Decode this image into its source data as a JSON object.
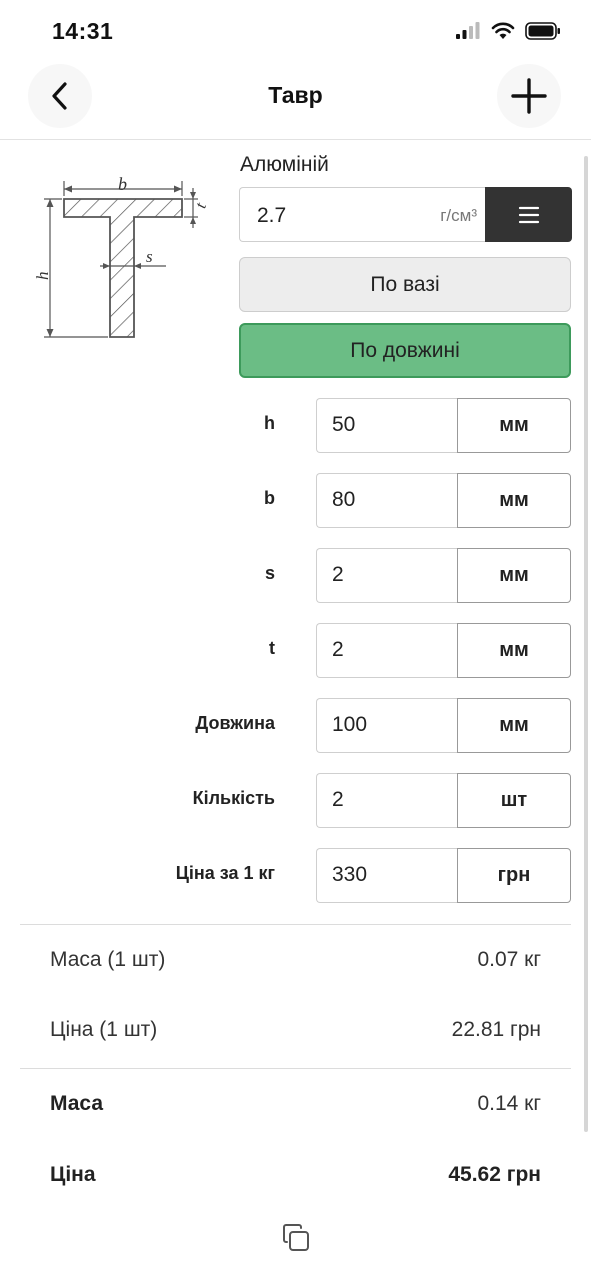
{
  "status": {
    "time": "14:31"
  },
  "nav": {
    "title": "Тавр",
    "back_icon": "chevron-left-icon",
    "add_icon": "plus-icon"
  },
  "diagram": {
    "label_b": "b",
    "label_t": "t",
    "label_h": "h",
    "label_s": "s"
  },
  "material": {
    "name": "Алюміній",
    "density_value": "2.7",
    "density_unit": "г/см³",
    "menu_icon": "hamburger-menu-icon"
  },
  "modes": {
    "by_weight": "По вазі",
    "by_length": "По довжині",
    "active": "by_length"
  },
  "params": [
    {
      "label": "h",
      "value": "50",
      "unit": "мм"
    },
    {
      "label": "b",
      "value": "80",
      "unit": "мм"
    },
    {
      "label": "s",
      "value": "2",
      "unit": "мм"
    },
    {
      "label": "t",
      "value": "2",
      "unit": "мм"
    },
    {
      "label": "Довжина",
      "value": "100",
      "unit": "мм"
    },
    {
      "label": "Кількість",
      "value": "2",
      "unit": "шт"
    },
    {
      "label": "Ціна за 1 кг",
      "value": "330",
      "unit": "грн"
    }
  ],
  "results": {
    "mass_one_label": "Маса (1 шт)",
    "mass_one_value": "0.07 кг",
    "price_one_label": "Ціна (1 шт)",
    "price_one_value": "22.81 грн",
    "mass_total_label": "Маса",
    "mass_total_value": "0.14 кг",
    "price_total_label": "Ціна",
    "price_total_value": "45.62 грн"
  },
  "colors": {
    "active_mode_bg": "#6bbd85",
    "active_mode_border": "#3d9a5b",
    "menu_button_bg": "#333333"
  }
}
